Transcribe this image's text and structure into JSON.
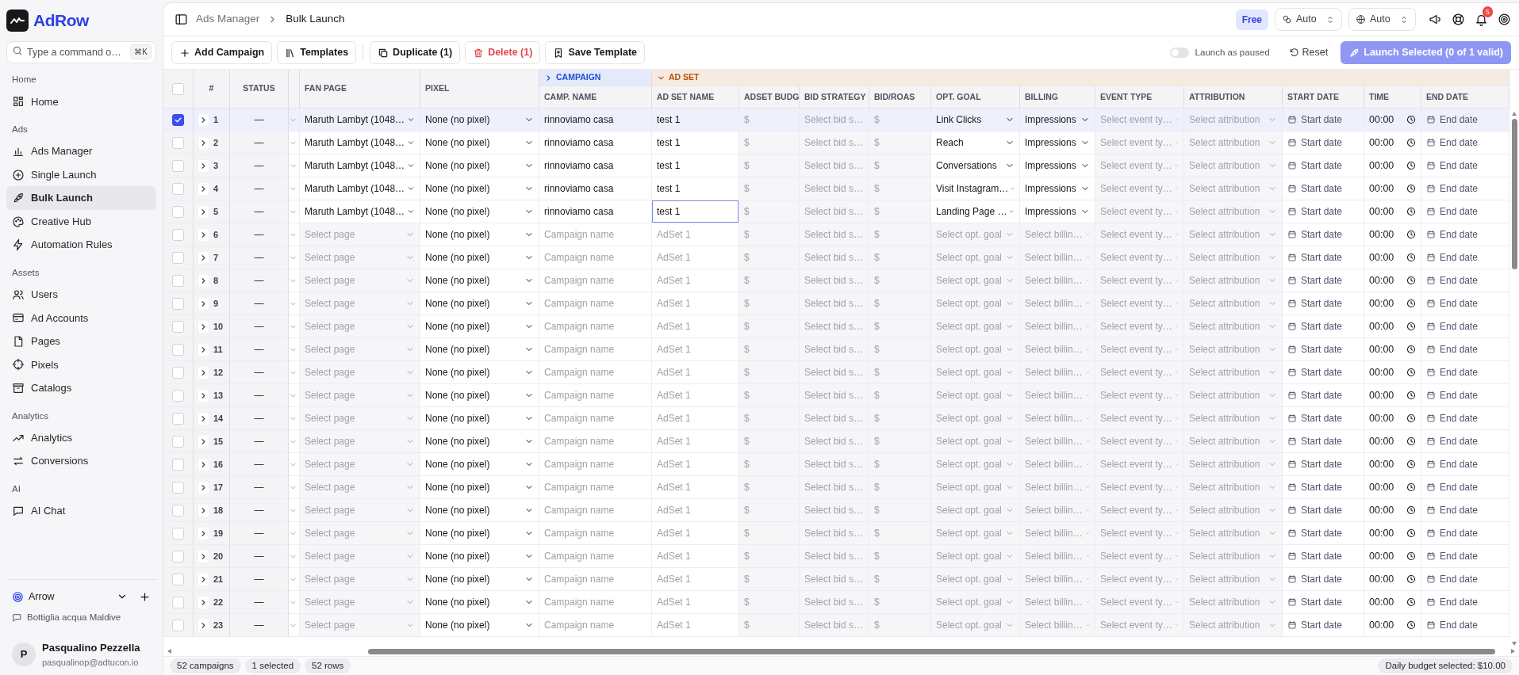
{
  "sidebar": {
    "logo": "AdRow",
    "search": {
      "placeholder": "Type a command o…",
      "shortcut": "⌘K"
    },
    "sections": [
      {
        "title": "Home",
        "items": [
          {
            "label": "Home",
            "selected": false
          }
        ]
      },
      {
        "title": "Ads",
        "items": [
          {
            "label": "Ads Manager",
            "selected": false
          },
          {
            "label": "Single Launch",
            "selected": false
          },
          {
            "label": "Bulk Launch",
            "selected": true
          },
          {
            "label": "Creative Hub",
            "selected": false
          },
          {
            "label": "Automation Rules",
            "selected": false
          }
        ]
      },
      {
        "title": "Assets",
        "items": [
          {
            "label": "Users",
            "selected": false
          },
          {
            "label": "Ad Accounts",
            "selected": false
          },
          {
            "label": "Pages",
            "selected": false
          },
          {
            "label": "Pixels",
            "selected": false
          },
          {
            "label": "Catalogs",
            "selected": false
          }
        ]
      },
      {
        "title": "Analytics",
        "items": [
          {
            "label": "Analytics",
            "selected": false
          },
          {
            "label": "Conversions",
            "selected": false
          }
        ]
      },
      {
        "title": "AI",
        "items": [
          {
            "label": "AI Chat",
            "selected": false
          }
        ]
      }
    ],
    "workspace": {
      "name": "Arrow"
    },
    "project": "Bottiglia acqua Maldive",
    "user": {
      "initial": "P",
      "name": "Pasqualino Pezzella",
      "email": "pasqualinop@adtucon.io"
    }
  },
  "header": {
    "breadcrumb": [
      "Ads Manager",
      "Bulk Launch"
    ],
    "plan": "Free",
    "selects": [
      "Auto",
      "Auto"
    ],
    "notifications": "5"
  },
  "toolbar": {
    "buttons": [
      {
        "label": "Add Campaign",
        "kind": "add"
      },
      {
        "label": "Templates",
        "kind": "templates"
      },
      {
        "label": "Duplicate (1)",
        "kind": "duplicate"
      },
      {
        "label": "Delete (1)",
        "kind": "delete"
      },
      {
        "label": "Save Template",
        "kind": "save"
      }
    ],
    "launch_paused": {
      "label": "Launch as paused",
      "on": false
    },
    "reset": "Reset",
    "launch": {
      "label": "Launch Selected (0 of 1 valid)",
      "disabled": true
    }
  },
  "table": {
    "select_all": {
      "checked": false
    },
    "columns": [
      {
        "label": "#",
        "kind": "number"
      },
      {
        "label": "STATUS",
        "kind": "status"
      },
      {
        "label": "FAN PAGE",
        "kind": "select"
      },
      {
        "label": "PIXEL",
        "kind": "select"
      }
    ],
    "groups": [
      {
        "label": "CAMPAIGN",
        "expanded": false,
        "color": "#1d4ed8",
        "columns": [
          {
            "label": "CAMP. NAME",
            "kind": "text"
          }
        ]
      },
      {
        "label": "AD SET",
        "expanded": true,
        "color": "#b45309",
        "columns": [
          {
            "label": "AD SET NAME",
            "kind": "text"
          },
          {
            "label": "ADSET BUDG",
            "kind": "money"
          },
          {
            "label": "BID STRATEGY",
            "kind": "select"
          },
          {
            "label": "BID/ROAS",
            "kind": "money"
          },
          {
            "label": "OPT. GOAL",
            "kind": "select"
          },
          {
            "label": "BILLING",
            "kind": "select"
          },
          {
            "label": "EVENT TYPE",
            "kind": "select"
          },
          {
            "label": "ATTRIBUTION",
            "kind": "select"
          },
          {
            "label": "START DATE",
            "kind": "date"
          },
          {
            "label": "TIME",
            "kind": "time"
          },
          {
            "label": "END DATE",
            "kind": "date"
          }
        ]
      }
    ],
    "rows": [
      {
        "selected": true,
        "cells": [
          {
            "value": "1",
            "expanded": false
          },
          {
            "value": "—"
          },
          {
            "value": "Maruth Lambyt (1048…"
          },
          {
            "value": "None (no pixel)"
          },
          {
            "value": "rinnoviamo casa",
            "focused": false
          },
          {
            "value": "test 1",
            "focused": false
          },
          {
            "prefix": "$"
          },
          {
            "placeholder": "Select bid s…"
          },
          {
            "prefix": "$"
          },
          {
            "value": "Link Clicks"
          },
          {
            "value": "Impressions"
          },
          {
            "placeholder": "Select event ty…"
          },
          {
            "placeholder": "Select attribution"
          },
          {
            "placeholder": "Start date"
          },
          {
            "value": "00:00"
          },
          {
            "placeholder": "End date"
          }
        ]
      },
      {
        "selected": false,
        "cells": [
          {
            "value": "2",
            "expanded": false
          },
          {
            "value": "—"
          },
          {
            "value": "Maruth Lambyt (1048…"
          },
          {
            "value": "None (no pixel)"
          },
          {
            "value": "rinnoviamo casa",
            "focused": false
          },
          {
            "value": "test 1",
            "focused": false
          },
          {
            "prefix": "$"
          },
          {
            "placeholder": "Select bid s…"
          },
          {
            "prefix": "$"
          },
          {
            "value": "Reach"
          },
          {
            "value": "Impressions"
          },
          {
            "placeholder": "Select event ty…"
          },
          {
            "placeholder": "Select attribution"
          },
          {
            "placeholder": "Start date"
          },
          {
            "value": "00:00"
          },
          {
            "placeholder": "End date"
          }
        ]
      },
      {
        "selected": false,
        "cells": [
          {
            "value": "3",
            "expanded": false
          },
          {
            "value": "—"
          },
          {
            "value": "Maruth Lambyt (1048…"
          },
          {
            "value": "None (no pixel)"
          },
          {
            "value": "rinnoviamo casa",
            "focused": false
          },
          {
            "value": "test 1",
            "focused": false
          },
          {
            "prefix": "$"
          },
          {
            "placeholder": "Select bid s…"
          },
          {
            "prefix": "$"
          },
          {
            "value": "Conversations"
          },
          {
            "value": "Impressions"
          },
          {
            "placeholder": "Select event ty…"
          },
          {
            "placeholder": "Select attribution"
          },
          {
            "placeholder": "Start date"
          },
          {
            "value": "00:00"
          },
          {
            "placeholder": "End date"
          }
        ]
      },
      {
        "selected": false,
        "cells": [
          {
            "value": "4",
            "expanded": false
          },
          {
            "value": "—"
          },
          {
            "value": "Maruth Lambyt (1048…"
          },
          {
            "value": "None (no pixel)"
          },
          {
            "value": "rinnoviamo casa",
            "focused": false
          },
          {
            "value": "test 1",
            "focused": false
          },
          {
            "prefix": "$"
          },
          {
            "placeholder": "Select bid s…"
          },
          {
            "prefix": "$"
          },
          {
            "value": "Visit Instagram…"
          },
          {
            "value": "Impressions"
          },
          {
            "placeholder": "Select event ty…"
          },
          {
            "placeholder": "Select attribution"
          },
          {
            "placeholder": "Start date"
          },
          {
            "value": "00:00"
          },
          {
            "placeholder": "End date"
          }
        ]
      },
      {
        "selected": false,
        "cells": [
          {
            "value": "5",
            "expanded": false
          },
          {
            "value": "—"
          },
          {
            "value": "Maruth Lambyt (1048…"
          },
          {
            "value": "None (no pixel)"
          },
          {
            "value": "rinnoviamo casa",
            "focused": false
          },
          {
            "value": "test 1",
            "focused": true
          },
          {
            "prefix": "$"
          },
          {
            "placeholder": "Select bid s…"
          },
          {
            "prefix": "$"
          },
          {
            "value": "Landing Page …"
          },
          {
            "value": "Impressions"
          },
          {
            "placeholder": "Select event ty…"
          },
          {
            "placeholder": "Select attribution"
          },
          {
            "placeholder": "Start date"
          },
          {
            "value": "00:00"
          },
          {
            "placeholder": "End date"
          }
        ]
      },
      {
        "selected": false,
        "cells": [
          {
            "value": "6",
            "expanded": false
          },
          {
            "value": "—"
          },
          {
            "placeholder": "Select page"
          },
          {
            "value": "None (no pixel)"
          },
          {
            "placeholder": "Campaign name",
            "focused": false
          },
          {
            "placeholder": "AdSet 1",
            "focused": false
          },
          {
            "prefix": "$"
          },
          {
            "placeholder": "Select bid s…"
          },
          {
            "prefix": "$"
          },
          {
            "placeholder": "Select opt. goal"
          },
          {
            "placeholder": "Select billin…"
          },
          {
            "placeholder": "Select event ty…"
          },
          {
            "placeholder": "Select attribution"
          },
          {
            "placeholder": "Start date"
          },
          {
            "value": "00:00"
          },
          {
            "placeholder": "End date"
          }
        ]
      },
      {
        "selected": false,
        "cells": [
          {
            "value": "7",
            "expanded": false
          },
          {
            "value": "—"
          },
          {
            "placeholder": "Select page"
          },
          {
            "value": "None (no pixel)"
          },
          {
            "placeholder": "Campaign name",
            "focused": false
          },
          {
            "placeholder": "AdSet 1",
            "focused": false
          },
          {
            "prefix": "$"
          },
          {
            "placeholder": "Select bid s…"
          },
          {
            "prefix": "$"
          },
          {
            "placeholder": "Select opt. goal"
          },
          {
            "placeholder": "Select billin…"
          },
          {
            "placeholder": "Select event ty…"
          },
          {
            "placeholder": "Select attribution"
          },
          {
            "placeholder": "Start date"
          },
          {
            "value": "00:00"
          },
          {
            "placeholder": "End date"
          }
        ]
      },
      {
        "selected": false,
        "cells": [
          {
            "value": "8",
            "expanded": false
          },
          {
            "value": "—"
          },
          {
            "placeholder": "Select page"
          },
          {
            "value": "None (no pixel)"
          },
          {
            "placeholder": "Campaign name",
            "focused": false
          },
          {
            "placeholder": "AdSet 1",
            "focused": false
          },
          {
            "prefix": "$"
          },
          {
            "placeholder": "Select bid s…"
          },
          {
            "prefix": "$"
          },
          {
            "placeholder": "Select opt. goal"
          },
          {
            "placeholder": "Select billin…"
          },
          {
            "placeholder": "Select event ty…"
          },
          {
            "placeholder": "Select attribution"
          },
          {
            "placeholder": "Start date"
          },
          {
            "value": "00:00"
          },
          {
            "placeholder": "End date"
          }
        ]
      },
      {
        "selected": false,
        "cells": [
          {
            "value": "9",
            "expanded": false
          },
          {
            "value": "—"
          },
          {
            "placeholder": "Select page"
          },
          {
            "value": "None (no pixel)"
          },
          {
            "placeholder": "Campaign name",
            "focused": false
          },
          {
            "placeholder": "AdSet 1",
            "focused": false
          },
          {
            "prefix": "$"
          },
          {
            "placeholder": "Select bid s…"
          },
          {
            "prefix": "$"
          },
          {
            "placeholder": "Select opt. goal"
          },
          {
            "placeholder": "Select billin…"
          },
          {
            "placeholder": "Select event ty…"
          },
          {
            "placeholder": "Select attribution"
          },
          {
            "placeholder": "Start date"
          },
          {
            "value": "00:00"
          },
          {
            "placeholder": "End date"
          }
        ]
      },
      {
        "selected": false,
        "cells": [
          {
            "value": "10",
            "expanded": false
          },
          {
            "value": "—"
          },
          {
            "placeholder": "Select page"
          },
          {
            "value": "None (no pixel)"
          },
          {
            "placeholder": "Campaign name",
            "focused": false
          },
          {
            "placeholder": "AdSet 1",
            "focused": false
          },
          {
            "prefix": "$"
          },
          {
            "placeholder": "Select bid s…"
          },
          {
            "prefix": "$"
          },
          {
            "placeholder": "Select opt. goal"
          },
          {
            "placeholder": "Select billin…"
          },
          {
            "placeholder": "Select event ty…"
          },
          {
            "placeholder": "Select attribution"
          },
          {
            "placeholder": "Start date"
          },
          {
            "value": "00:00"
          },
          {
            "placeholder": "End date"
          }
        ]
      },
      {
        "selected": false,
        "cells": [
          {
            "value": "11",
            "expanded": false
          },
          {
            "value": "—"
          },
          {
            "placeholder": "Select page"
          },
          {
            "value": "None (no pixel)"
          },
          {
            "placeholder": "Campaign name",
            "focused": false
          },
          {
            "placeholder": "AdSet 1",
            "focused": false
          },
          {
            "prefix": "$"
          },
          {
            "placeholder": "Select bid s…"
          },
          {
            "prefix": "$"
          },
          {
            "placeholder": "Select opt. goal"
          },
          {
            "placeholder": "Select billin…"
          },
          {
            "placeholder": "Select event ty…"
          },
          {
            "placeholder": "Select attribution"
          },
          {
            "placeholder": "Start date"
          },
          {
            "value": "00:00"
          },
          {
            "placeholder": "End date"
          }
        ]
      },
      {
        "selected": false,
        "cells": [
          {
            "value": "12",
            "expanded": false
          },
          {
            "value": "—"
          },
          {
            "placeholder": "Select page"
          },
          {
            "value": "None (no pixel)"
          },
          {
            "placeholder": "Campaign name",
            "focused": false
          },
          {
            "placeholder": "AdSet 1",
            "focused": false
          },
          {
            "prefix": "$"
          },
          {
            "placeholder": "Select bid s…"
          },
          {
            "prefix": "$"
          },
          {
            "placeholder": "Select opt. goal"
          },
          {
            "placeholder": "Select billin…"
          },
          {
            "placeholder": "Select event ty…"
          },
          {
            "placeholder": "Select attribution"
          },
          {
            "placeholder": "Start date"
          },
          {
            "value": "00:00"
          },
          {
            "placeholder": "End date"
          }
        ]
      },
      {
        "selected": false,
        "cells": [
          {
            "value": "13",
            "expanded": false
          },
          {
            "value": "—"
          },
          {
            "placeholder": "Select page"
          },
          {
            "value": "None (no pixel)"
          },
          {
            "placeholder": "Campaign name",
            "focused": false
          },
          {
            "placeholder": "AdSet 1",
            "focused": false
          },
          {
            "prefix": "$"
          },
          {
            "placeholder": "Select bid s…"
          },
          {
            "prefix": "$"
          },
          {
            "placeholder": "Select opt. goal"
          },
          {
            "placeholder": "Select billin…"
          },
          {
            "placeholder": "Select event ty…"
          },
          {
            "placeholder": "Select attribution"
          },
          {
            "placeholder": "Start date"
          },
          {
            "value": "00:00"
          },
          {
            "placeholder": "End date"
          }
        ]
      },
      {
        "selected": false,
        "cells": [
          {
            "value": "14",
            "expanded": false
          },
          {
            "value": "—"
          },
          {
            "placeholder": "Select page"
          },
          {
            "value": "None (no pixel)"
          },
          {
            "placeholder": "Campaign name",
            "focused": false
          },
          {
            "placeholder": "AdSet 1",
            "focused": false
          },
          {
            "prefix": "$"
          },
          {
            "placeholder": "Select bid s…"
          },
          {
            "prefix": "$"
          },
          {
            "placeholder": "Select opt. goal"
          },
          {
            "placeholder": "Select billin…"
          },
          {
            "placeholder": "Select event ty…"
          },
          {
            "placeholder": "Select attribution"
          },
          {
            "placeholder": "Start date"
          },
          {
            "value": "00:00"
          },
          {
            "placeholder": "End date"
          }
        ]
      },
      {
        "selected": false,
        "cells": [
          {
            "value": "15",
            "expanded": false
          },
          {
            "value": "—"
          },
          {
            "placeholder": "Select page"
          },
          {
            "value": "None (no pixel)"
          },
          {
            "placeholder": "Campaign name",
            "focused": false
          },
          {
            "placeholder": "AdSet 1",
            "focused": false
          },
          {
            "prefix": "$"
          },
          {
            "placeholder": "Select bid s…"
          },
          {
            "prefix": "$"
          },
          {
            "placeholder": "Select opt. goal"
          },
          {
            "placeholder": "Select billin…"
          },
          {
            "placeholder": "Select event ty…"
          },
          {
            "placeholder": "Select attribution"
          },
          {
            "placeholder": "Start date"
          },
          {
            "value": "00:00"
          },
          {
            "placeholder": "End date"
          }
        ]
      },
      {
        "selected": false,
        "cells": [
          {
            "value": "16",
            "expanded": false
          },
          {
            "value": "—"
          },
          {
            "placeholder": "Select page"
          },
          {
            "value": "None (no pixel)"
          },
          {
            "placeholder": "Campaign name",
            "focused": false
          },
          {
            "placeholder": "AdSet 1",
            "focused": false
          },
          {
            "prefix": "$"
          },
          {
            "placeholder": "Select bid s…"
          },
          {
            "prefix": "$"
          },
          {
            "placeholder": "Select opt. goal"
          },
          {
            "placeholder": "Select billin…"
          },
          {
            "placeholder": "Select event ty…"
          },
          {
            "placeholder": "Select attribution"
          },
          {
            "placeholder": "Start date"
          },
          {
            "value": "00:00"
          },
          {
            "placeholder": "End date"
          }
        ]
      },
      {
        "selected": false,
        "cells": [
          {
            "value": "17",
            "expanded": false
          },
          {
            "value": "—"
          },
          {
            "placeholder": "Select page"
          },
          {
            "value": "None (no pixel)"
          },
          {
            "placeholder": "Campaign name",
            "focused": false
          },
          {
            "placeholder": "AdSet 1",
            "focused": false
          },
          {
            "prefix": "$"
          },
          {
            "placeholder": "Select bid s…"
          },
          {
            "prefix": "$"
          },
          {
            "placeholder": "Select opt. goal"
          },
          {
            "placeholder": "Select billin…"
          },
          {
            "placeholder": "Select event ty…"
          },
          {
            "placeholder": "Select attribution"
          },
          {
            "placeholder": "Start date"
          },
          {
            "value": "00:00"
          },
          {
            "placeholder": "End date"
          }
        ]
      },
      {
        "selected": false,
        "cells": [
          {
            "value": "18",
            "expanded": false
          },
          {
            "value": "—"
          },
          {
            "placeholder": "Select page"
          },
          {
            "value": "None (no pixel)"
          },
          {
            "placeholder": "Campaign name",
            "focused": false
          },
          {
            "placeholder": "AdSet 1",
            "focused": false
          },
          {
            "prefix": "$"
          },
          {
            "placeholder": "Select bid s…"
          },
          {
            "prefix": "$"
          },
          {
            "placeholder": "Select opt. goal"
          },
          {
            "placeholder": "Select billin…"
          },
          {
            "placeholder": "Select event ty…"
          },
          {
            "placeholder": "Select attribution"
          },
          {
            "placeholder": "Start date"
          },
          {
            "value": "00:00"
          },
          {
            "placeholder": "End date"
          }
        ]
      },
      {
        "selected": false,
        "cells": [
          {
            "value": "19",
            "expanded": false
          },
          {
            "value": "—"
          },
          {
            "placeholder": "Select page"
          },
          {
            "value": "None (no pixel)"
          },
          {
            "placeholder": "Campaign name",
            "focused": false
          },
          {
            "placeholder": "AdSet 1",
            "focused": false
          },
          {
            "prefix": "$"
          },
          {
            "placeholder": "Select bid s…"
          },
          {
            "prefix": "$"
          },
          {
            "placeholder": "Select opt. goal"
          },
          {
            "placeholder": "Select billin…"
          },
          {
            "placeholder": "Select event ty…"
          },
          {
            "placeholder": "Select attribution"
          },
          {
            "placeholder": "Start date"
          },
          {
            "value": "00:00"
          },
          {
            "placeholder": "End date"
          }
        ]
      },
      {
        "selected": false,
        "cells": [
          {
            "value": "20",
            "expanded": false
          },
          {
            "value": "—"
          },
          {
            "placeholder": "Select page"
          },
          {
            "value": "None (no pixel)"
          },
          {
            "placeholder": "Campaign name",
            "focused": false
          },
          {
            "placeholder": "AdSet 1",
            "focused": false
          },
          {
            "prefix": "$"
          },
          {
            "placeholder": "Select bid s…"
          },
          {
            "prefix": "$"
          },
          {
            "placeholder": "Select opt. goal"
          },
          {
            "placeholder": "Select billin…"
          },
          {
            "placeholder": "Select event ty…"
          },
          {
            "placeholder": "Select attribution"
          },
          {
            "placeholder": "Start date"
          },
          {
            "value": "00:00"
          },
          {
            "placeholder": "End date"
          }
        ]
      },
      {
        "selected": false,
        "cells": [
          {
            "value": "21",
            "expanded": false
          },
          {
            "value": "—"
          },
          {
            "placeholder": "Select page"
          },
          {
            "value": "None (no pixel)"
          },
          {
            "placeholder": "Campaign name",
            "focused": false
          },
          {
            "placeholder": "AdSet 1",
            "focused": false
          },
          {
            "prefix": "$"
          },
          {
            "placeholder": "Select bid s…"
          },
          {
            "prefix": "$"
          },
          {
            "placeholder": "Select opt. goal"
          },
          {
            "placeholder": "Select billin…"
          },
          {
            "placeholder": "Select event ty…"
          },
          {
            "placeholder": "Select attribution"
          },
          {
            "placeholder": "Start date"
          },
          {
            "value": "00:00"
          },
          {
            "placeholder": "End date"
          }
        ]
      },
      {
        "selected": false,
        "cells": [
          {
            "value": "22",
            "expanded": false
          },
          {
            "value": "—"
          },
          {
            "placeholder": "Select page"
          },
          {
            "value": "None (no pixel)"
          },
          {
            "placeholder": "Campaign name",
            "focused": false
          },
          {
            "placeholder": "AdSet 1",
            "focused": false
          },
          {
            "prefix": "$"
          },
          {
            "placeholder": "Select bid s…"
          },
          {
            "prefix": "$"
          },
          {
            "placeholder": "Select opt. goal"
          },
          {
            "placeholder": "Select billin…"
          },
          {
            "placeholder": "Select event ty…"
          },
          {
            "placeholder": "Select attribution"
          },
          {
            "placeholder": "Start date"
          },
          {
            "value": "00:00"
          },
          {
            "placeholder": "End date"
          }
        ]
      },
      {
        "selected": false,
        "cells": [
          {
            "value": "23",
            "expanded": false
          },
          {
            "value": "—"
          },
          {
            "placeholder": "Select page"
          },
          {
            "value": "None (no pixel)"
          },
          {
            "placeholder": "Campaign name",
            "focused": false
          },
          {
            "placeholder": "AdSet 1",
            "focused": false
          },
          {
            "prefix": "$"
          },
          {
            "placeholder": "Select bid s…"
          },
          {
            "prefix": "$"
          },
          {
            "placeholder": "Select opt. goal"
          },
          {
            "placeholder": "Select billin…"
          },
          {
            "placeholder": "Select event ty…"
          },
          {
            "placeholder": "Select attribution"
          },
          {
            "placeholder": "Start date"
          },
          {
            "value": "00:00"
          },
          {
            "placeholder": "End date"
          }
        ]
      }
    ]
  },
  "status_bar": {
    "pills": [
      "52 campaigns",
      "1 selected",
      "52 rows"
    ],
    "budget": "Daily budget selected: $10.00"
  }
}
